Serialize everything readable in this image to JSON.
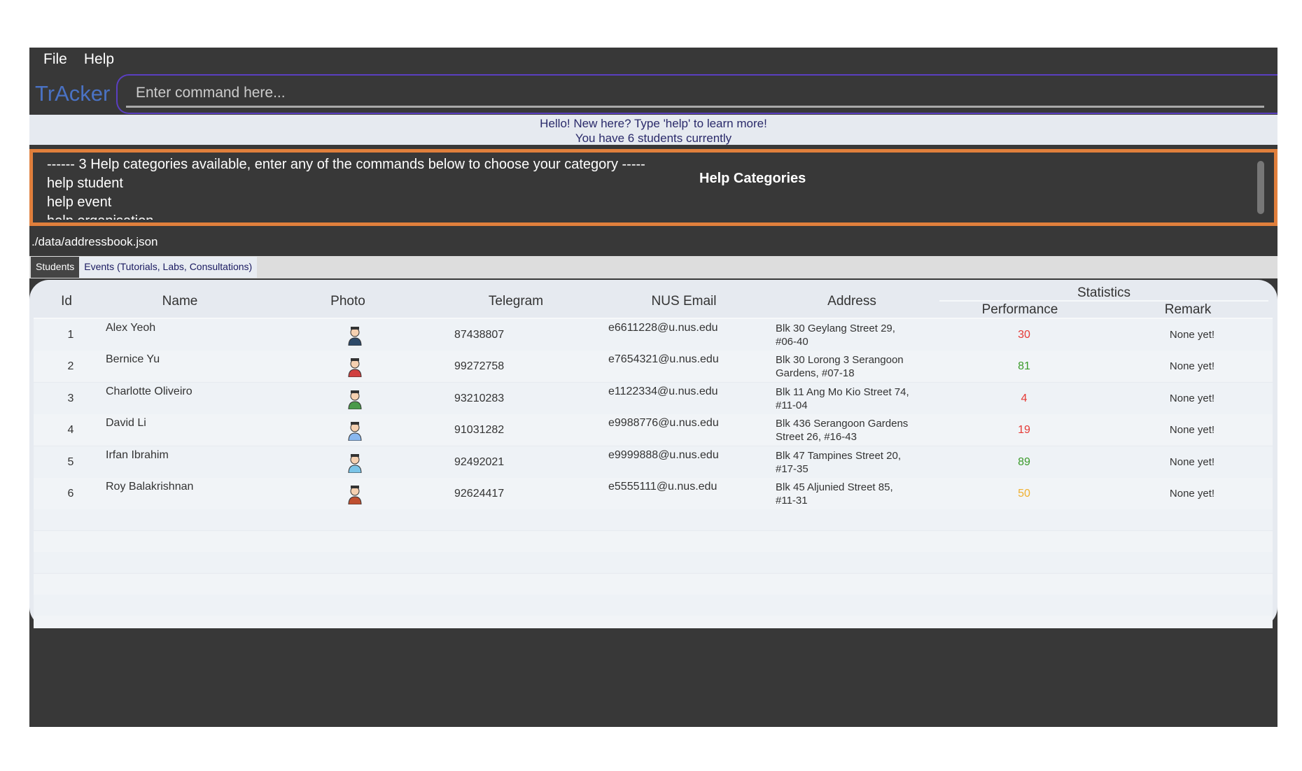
{
  "menu": {
    "file": "File",
    "help": "Help"
  },
  "brand": "TrAcker",
  "command": {
    "placeholder": "Enter command here...",
    "value": ""
  },
  "welcome": {
    "line1": "Hello! New here? Type 'help' to learn more!",
    "line2": "You have 6 students currently"
  },
  "result": {
    "lines": [
      "------ 3 Help categories available, enter any of the commands below to choose your category -----",
      "help student",
      "help event",
      "help organisation"
    ]
  },
  "annotation": "Help Categories",
  "colors": {
    "annotation": "#e07f3c",
    "brand": "#4a72c4",
    "low": "#e53935",
    "high": "#3a9a2a",
    "mid": "#f0b030"
  },
  "file_path": "./data/addressbook.json",
  "tabs": [
    {
      "label": "Students",
      "selected": true
    },
    {
      "label": "Events (Tutorials, Labs, Consultations)",
      "selected": false
    }
  ],
  "table": {
    "headers": {
      "id": "Id",
      "name": "Name",
      "photo": "Photo",
      "telegram": "Telegram",
      "email": "NUS Email",
      "address": "Address",
      "statistics": "Statistics",
      "performance": "Performance",
      "remark": "Remark"
    },
    "rows": [
      {
        "id": "1",
        "name": "Alex Yeoh",
        "photo": "graduate-avatar-icon",
        "telegram": "87438807",
        "email": "e6611228@u.nus.edu",
        "address1": "Blk 30 Geylang Street 29,",
        "address2": "#06-40",
        "performance": "30",
        "perf_color": "#e53935",
        "remark": "None yet!"
      },
      {
        "id": "2",
        "name": "Bernice Yu",
        "photo": "student-reading-avatar-icon",
        "telegram": "99272758",
        "email": "e7654321@u.nus.edu",
        "address1": "Blk 30 Lorong 3 Serangoon",
        "address2": "Gardens, #07-18",
        "performance": "81",
        "perf_color": "#3a9a2a",
        "remark": "None yet!"
      },
      {
        "id": "3",
        "name": "Charlotte Oliveiro",
        "photo": "student-thinking-avatar-icon",
        "telegram": "93210283",
        "email": "e1122334@u.nus.edu",
        "address1": "Blk 11 Ang Mo Kio Street 74,",
        "address2": "#11-04",
        "performance": "4",
        "perf_color": "#e53935",
        "remark": "None yet!"
      },
      {
        "id": "4",
        "name": "David Li",
        "photo": "online-learning-avatar-icon",
        "telegram": "91031282",
        "email": "e9988776@u.nus.edu",
        "address1": "Blk 436 Serangoon Gardens",
        "address2": "Street 26, #16-43",
        "performance": "19",
        "perf_color": "#e53935",
        "remark": "None yet!"
      },
      {
        "id": "5",
        "name": "Irfan Ibrahim",
        "photo": "student-boy-avatar-icon",
        "telegram": "92492021",
        "email": "e9999888@u.nus.edu",
        "address1": "Blk 47 Tampines Street 20,",
        "address2": "#17-35",
        "performance": "89",
        "perf_color": "#3a9a2a",
        "remark": "None yet!"
      },
      {
        "id": "6",
        "name": "Roy Balakrishnan",
        "photo": "student-redhair-avatar-icon",
        "telegram": "92624417",
        "email": "e5555111@u.nus.edu",
        "address1": "Blk 45 Aljunied Street 85,",
        "address2": "#11-31",
        "performance": "50",
        "perf_color": "#f0b030",
        "remark": "None yet!"
      }
    ]
  }
}
